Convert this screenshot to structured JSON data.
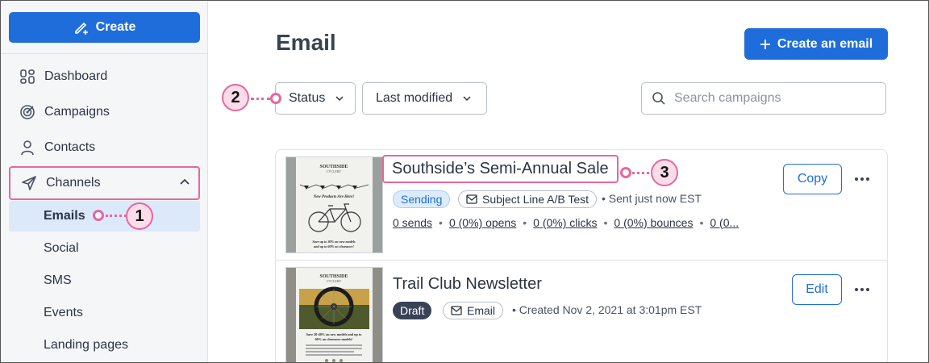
{
  "sidebar": {
    "create_label": "Create",
    "items": [
      {
        "label": "Dashboard",
        "icon": "dashboard-icon"
      },
      {
        "label": "Campaigns",
        "icon": "target-icon"
      },
      {
        "label": "Contacts",
        "icon": "person-icon"
      },
      {
        "label": "Channels",
        "icon": "send-icon"
      }
    ],
    "channels_sub": [
      "Emails",
      "Social",
      "SMS",
      "Events",
      "Landing pages"
    ]
  },
  "main": {
    "title": "Email",
    "create_email_label": "Create an email",
    "filters": {
      "status": "Status",
      "last_modified": "Last modified"
    },
    "search_placeholder": "Search campaigns"
  },
  "campaigns": [
    {
      "title": "Southside’s Semi-Annual Sale",
      "status": "Sending",
      "type": "Subject Line A/B Test",
      "meta": "Sent just now EST",
      "stats": [
        "0 sends",
        "0 (0%) opens",
        "0 (0%) clicks",
        "0 (0%) bounces",
        "0 (0..."
      ],
      "action": "Copy"
    },
    {
      "title": "Trail Club Newsletter",
      "status": "Draft",
      "type": "Email",
      "meta": "Created Nov 2, 2021 at 3:01pm EST",
      "action": "Edit"
    }
  ],
  "thumb1": {
    "brand": "SOUTHSIDE",
    "sub": "CYCLERY",
    "headline": "New Products Are Here!",
    "footer": "Save up to 30% on new models and up to 60% on clearance!"
  },
  "thumb2": {
    "brand": "SOUTHSIDE",
    "sub": "CYCLERY",
    "footer": "Save 20-40% on new models and up to 60% on clearance models!"
  },
  "callouts": [
    "1",
    "2",
    "3"
  ],
  "colors": {
    "accent": "#1f6ddb",
    "highlight": "#e8669e",
    "active_bg": "#dbe9fb"
  }
}
